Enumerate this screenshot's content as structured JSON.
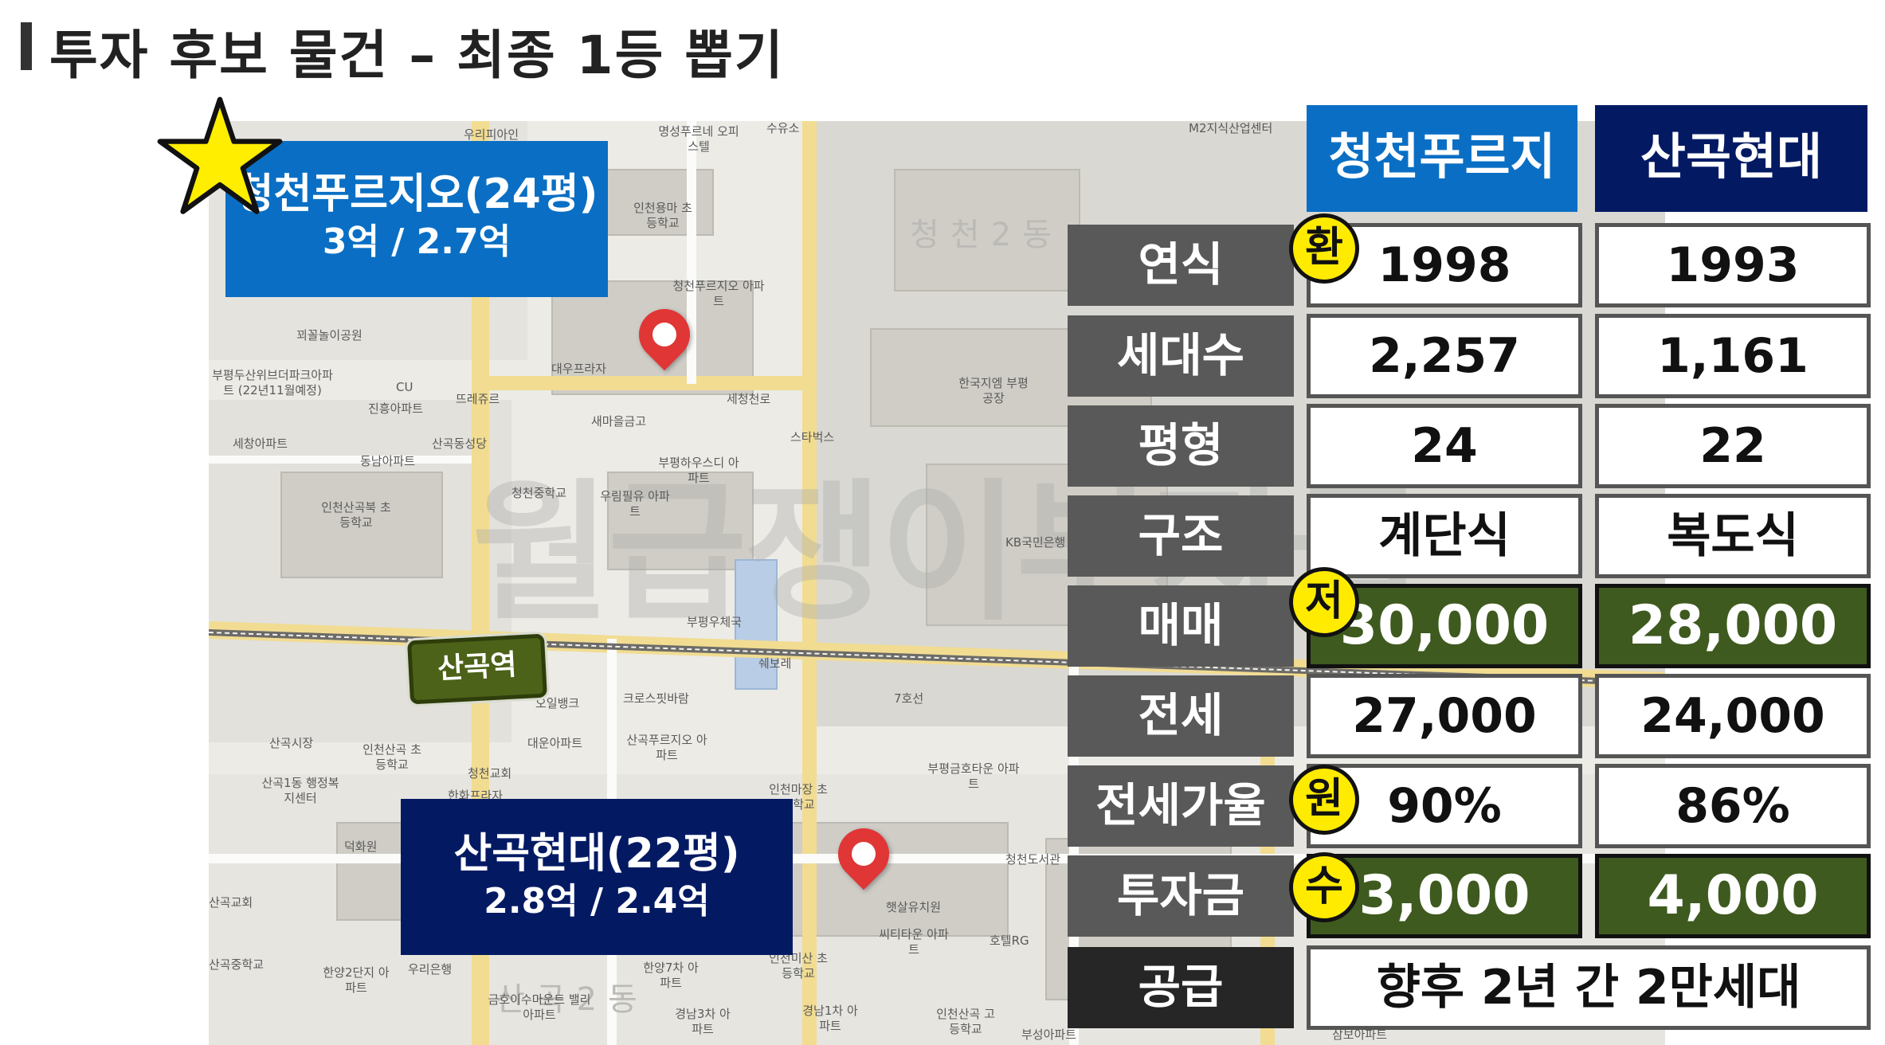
{
  "slide": {
    "title": "투자 후보 물건  –  최종 1등 뽑기"
  },
  "map": {
    "district_1": "청천2동",
    "district_2": "산곡2동",
    "watermark": "월급쟁이부자들",
    "station": "산곡역",
    "pois": [
      "우리피아인",
      "명성푸르네 오피스텔",
      "수유소",
      "M2지식산업센터",
      "인천용마 초등학교",
      "청천푸르지오 아파트",
      "꾀꼴놀이공원",
      "대우프라자",
      "부평두산위브더파크아파트 (22년11월예정)",
      "CU",
      "뜨레쥬르",
      "진흥아파트",
      "세청천로",
      "새마을금고",
      "한국지엠 부평공장",
      "세창아파트",
      "산곡동성당",
      "동남아파트",
      "스타벅스",
      "부평하우스디 아파트",
      "청천중학교",
      "우림필유 아파트",
      "인천산곡북 초등학교",
      "KB국민은행",
      "부평우체국",
      "쉐보레",
      "오일뱅크",
      "크로스핏바람",
      "7호선",
      "산곡시장",
      "인천산곡 초등학교",
      "대운아파트",
      "산곡푸르지오 아파트",
      "산곡1동 행정복지센터",
      "청천교회",
      "한화프라자",
      "인천마장 초등학교",
      "부평금호타운 아파트",
      "덕화원",
      "청천도서관",
      "산곡교회",
      "햇살유치원",
      "씨티타운 아파트",
      "호텔RG",
      "우리은행",
      "산곡중학교",
      "한양2단지 아파트",
      "금호이수마운트 밸리아파트",
      "한양7차 아파트",
      "인천미산 초등학교",
      "경남3차 아파트",
      "경남1차 아파트",
      "인천산곡 고등학교",
      "부성아파트",
      "삼보아파트"
    ]
  },
  "labels": {
    "cheongcheon": {
      "line1": "청천푸르지오(24평)",
      "line2": "3억 / 2.7억"
    },
    "sangok": {
      "line1": "산곡현대(22평)",
      "line2": "2.8억 / 2.4억"
    }
  },
  "table": {
    "headers": [
      "청천푸르지오",
      "산곡현대"
    ],
    "rows": [
      {
        "label": "연식",
        "a": "1998",
        "b": "1993",
        "badge": "환"
      },
      {
        "label": "세대수",
        "a": "2,257",
        "b": "1,161",
        "badge": ""
      },
      {
        "label": "평형",
        "a": "24",
        "b": "22",
        "badge": ""
      },
      {
        "label": "구조",
        "a": "계단식",
        "b": "복도식",
        "badge": ""
      },
      {
        "label": "매매",
        "a": "30,000",
        "b": "28,000",
        "badge": "저"
      },
      {
        "label": "전세",
        "a": "27,000",
        "b": "24,000",
        "badge": ""
      },
      {
        "label": "전세가율",
        "a": "90%",
        "b": "86%",
        "badge": "원"
      },
      {
        "label": "투자금",
        "a": "3,000",
        "b": "4,000",
        "badge": "수"
      },
      {
        "label": "공급",
        "merged": "향후 2년 간 2만세대"
      }
    ]
  },
  "colors": {
    "header_a": "#0a6fc4",
    "header_b": "#031a63",
    "highlight_green": "#3e5a1f",
    "badge_yellow": "#ffeb00"
  }
}
